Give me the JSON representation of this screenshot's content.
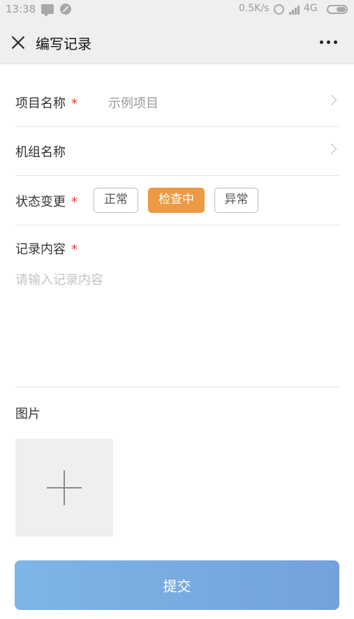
{
  "status_bar": {
    "time": "13:38",
    "network_speed": "0.5K/s",
    "network_type": "4G",
    "icons": [
      "message-icon",
      "blocked-icon",
      "alarm-icon",
      "signal-icon",
      "battery-icon"
    ]
  },
  "nav": {
    "title": "编写记录",
    "close_icon": "close-icon",
    "more_icon": "more-icon"
  },
  "form": {
    "project": {
      "label": "项目名称",
      "required_mark": "*",
      "value": "示例项目"
    },
    "unit": {
      "label": "机组名称",
      "value": ""
    },
    "status": {
      "label": "状态变更",
      "required_mark": "*",
      "options": [
        "正常",
        "检查中",
        "异常"
      ],
      "selected": "检查中"
    },
    "content": {
      "label": "记录内容",
      "required_mark": "*",
      "placeholder": "请输入记录内容",
      "value": ""
    },
    "images": {
      "label": "图片",
      "add_icon": "plus-icon"
    },
    "submit_label": "提交"
  },
  "colors": {
    "accent_selected": "#ec9a44",
    "required": "#e33b2e",
    "submit_start": "#7eb5e6",
    "submit_end": "#74a1dc"
  }
}
